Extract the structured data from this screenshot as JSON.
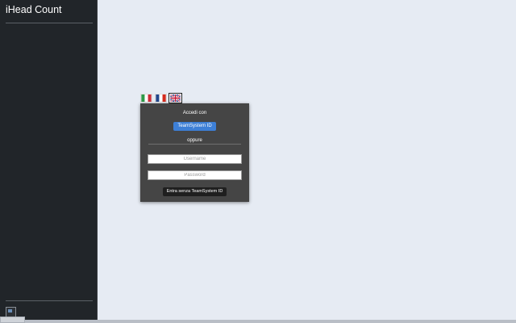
{
  "app": {
    "title": "iHead Count"
  },
  "languages": [
    {
      "code": "it",
      "icon": "italy-flag-icon"
    },
    {
      "code": "fr",
      "icon": "france-flag-icon"
    },
    {
      "code": "en",
      "icon": "uk-flag-icon"
    }
  ],
  "login": {
    "access_label": "Accedi con",
    "teamsystem_button": "TeamSystem ID",
    "or_label": "oppure",
    "username_placeholder": "Username",
    "password_placeholder": "Password",
    "enter_button": "Entra senza TeamSystem ID"
  },
  "colors": {
    "sidebar_bg": "#212529",
    "page_bg": "#e6ebf3",
    "panel_bg": "#454545",
    "primary_button": "#3d7fd6",
    "dark_button": "#1f1f1f"
  }
}
